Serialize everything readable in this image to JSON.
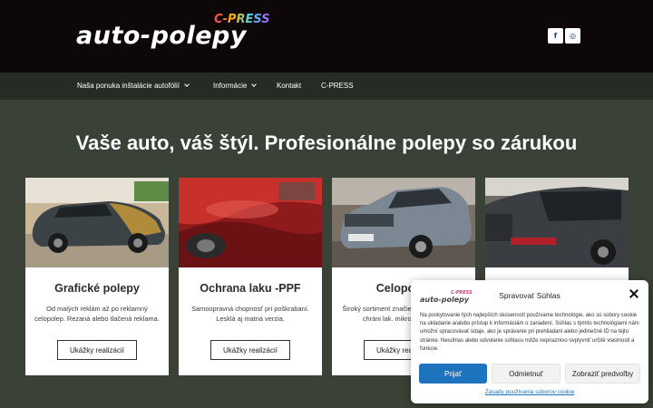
{
  "header": {
    "logo_main": "auto-polepy",
    "logo_sub": "C-PRESS",
    "social": [
      {
        "icon": "facebook-icon",
        "glyph": "f"
      },
      {
        "icon": "instagram-icon",
        "glyph": "◎"
      }
    ]
  },
  "nav": {
    "items": [
      {
        "label": "Naša ponuka inštalácie autofólií",
        "has_dropdown": true
      },
      {
        "label": "Informácie",
        "has_dropdown": true
      },
      {
        "label": "Kontakt",
        "has_dropdown": false
      },
      {
        "label": "C-PRESS",
        "has_dropdown": false
      }
    ]
  },
  "main": {
    "headline": "Vaše auto, váš štýl.  Profesionálne polepy so zárukou",
    "cards": [
      {
        "title": "Grafické polepy",
        "desc": "Od malých reklám až po reklamný celopolep. Rezaná alebo tlačená reklama.",
        "button": "Ukážky realizácií"
      },
      {
        "title": "Ochrana laku -PPF",
        "desc": "Samoopravná chopnosť pri poškrabaní. Lesklá aj matná verzia.",
        "button": "Ukážky realizácií"
      },
      {
        "title": "Celopolep",
        "desc": "Široký sortiment značiek. Zmení vzhľad a chráni lak. mikro-škrabance",
        "button": "Ukážky realizácií"
      },
      {
        "title": "",
        "desc": "",
        "button": ""
      }
    ]
  },
  "cookie": {
    "logo_main": "auto-polepy",
    "logo_sub": "C-PRESS",
    "title": "Spravovať Súhlas",
    "text": "Na poskytovanie tých najlepších skúseností používame technológie, ako sú súbory cookie na ukladanie a/alebo prístup k informáciám o zariadení. Súhlas s týmito technológiami nám umožní spracovávať údaje, ako je správanie pri prehliadaní alebo jedinečné ID na tejto stránke. Nesúhlas alebo odvolanie súhlasu môže nepriaznivo ovplyvniť určité vlastnosti a funkcie.",
    "accept": "Prijať",
    "deny": "Odmietnuť",
    "preferences": "Zobraziť predvoľby",
    "policy_link": "Zásady používania súborov cookie"
  },
  "colors": {
    "header_bg": "#0e0708",
    "nav_bg": "#262c25",
    "page_bg": "#3a4136",
    "accent": "#1e73be"
  }
}
